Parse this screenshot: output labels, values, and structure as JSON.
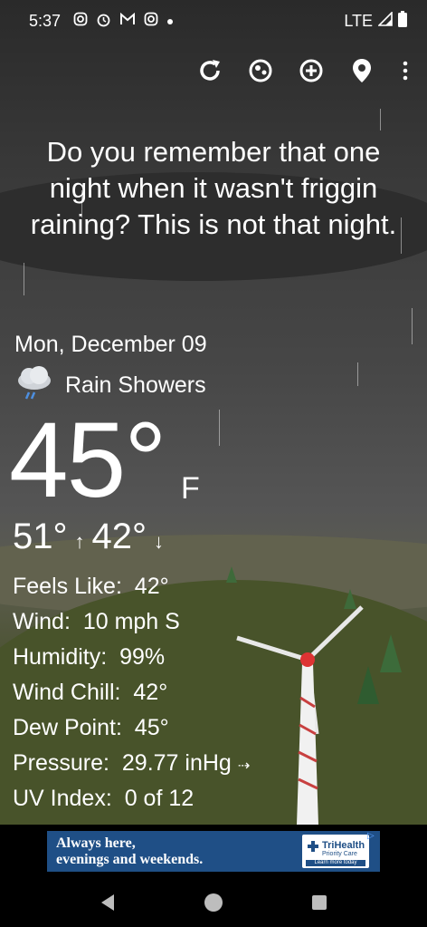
{
  "status_bar": {
    "time": "5:37",
    "network": "LTE",
    "notification_icons": [
      "instagram-icon",
      "alarm-icon",
      "gmail-icon",
      "instagram-icon",
      "dot-icon"
    ]
  },
  "toolbar": {
    "icons": [
      "refresh-icon",
      "theme-icon",
      "add-icon",
      "location-icon",
      "more-vert-icon"
    ]
  },
  "message": "Do you remember that one night when it wasn't friggin raining? This is not that night.",
  "weather": {
    "date": "Mon, December 09",
    "condition": "Rain Showers",
    "temperature": "45°",
    "unit": "F",
    "high": "51°",
    "low": "42°"
  },
  "details": [
    {
      "label": "Feels Like:",
      "value": "42°"
    },
    {
      "label": "Wind:",
      "value": "10 mph S"
    },
    {
      "label": "Humidity:",
      "value": "99%"
    },
    {
      "label": "Wind Chill:",
      "value": "42°"
    },
    {
      "label": "Dew Point:",
      "value": "45°"
    },
    {
      "label": "Pressure:",
      "value": "29.77 inHg"
    },
    {
      "label": "UV Index:",
      "value": "0 of 12"
    }
  ],
  "ad": {
    "headline_1": "Always here,",
    "headline_2": "evenings and weekends.",
    "brand": "TriHealth",
    "brand_sub": "Priority Care",
    "cta": "Learn more today"
  },
  "colors": {
    "ad_blue": "#1f4f86",
    "text": "#ffffff"
  }
}
